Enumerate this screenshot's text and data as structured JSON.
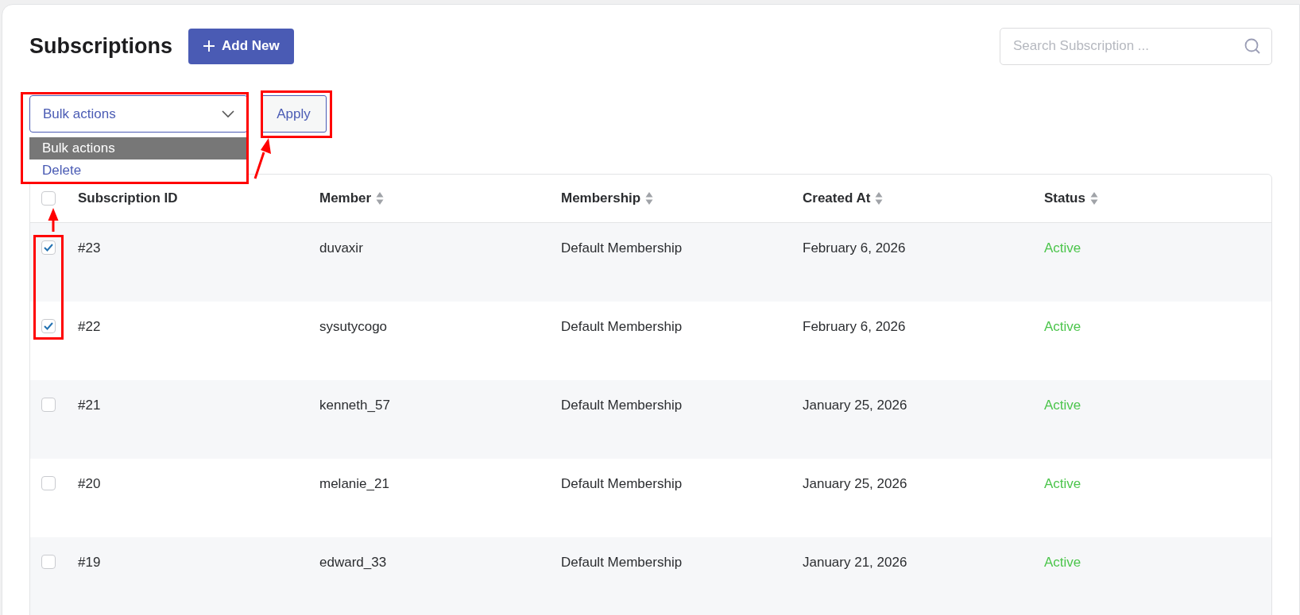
{
  "page": {
    "title": "Subscriptions",
    "add_button": "Add New",
    "search": {
      "placeholder": "Search Subscription ..."
    }
  },
  "bulk": {
    "value": "Bulk actions",
    "options": [
      {
        "label": "Bulk actions",
        "selected": true
      },
      {
        "label": "Delete",
        "selected": false
      }
    ],
    "apply": "Apply"
  },
  "table": {
    "all_checked": false,
    "columns": [
      {
        "label": "Subscription ID",
        "sortable": false
      },
      {
        "label": "Member",
        "sortable": true
      },
      {
        "label": "Membership",
        "sortable": true
      },
      {
        "label": "Created At",
        "sortable": true
      },
      {
        "label": "Status",
        "sortable": true
      }
    ],
    "rows": [
      {
        "checked": true,
        "cells": [
          "#23",
          "duvaxir",
          "Default Membership",
          "February 6, 2026",
          "Active"
        ]
      },
      {
        "checked": true,
        "cells": [
          "#22",
          "sysutycogo",
          "Default Membership",
          "February 6, 2026",
          "Active"
        ]
      },
      {
        "checked": false,
        "cells": [
          "#21",
          "kenneth_57",
          "Default Membership",
          "January 25, 2026",
          "Active"
        ]
      },
      {
        "checked": false,
        "cells": [
          "#20",
          "melanie_21",
          "Default Membership",
          "January 25, 2026",
          "Active"
        ]
      },
      {
        "checked": false,
        "cells": [
          "#19",
          "edward_33",
          "Default Membership",
          "January 21, 2026",
          "Active"
        ]
      }
    ]
  }
}
